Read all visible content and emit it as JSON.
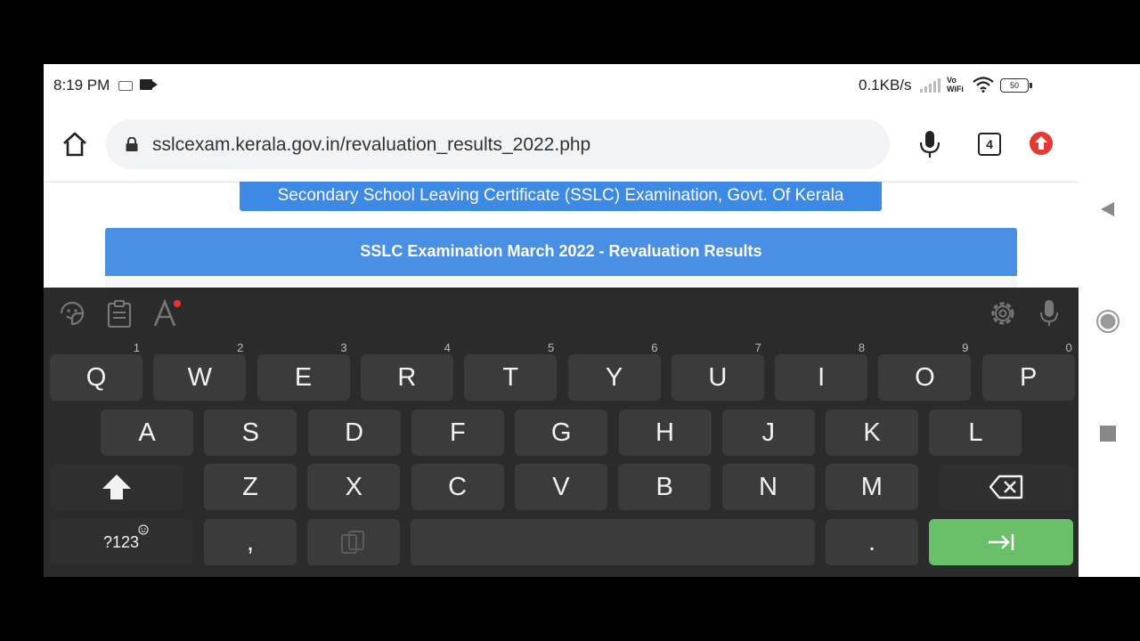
{
  "status_bar": {
    "time": "8:19 PM",
    "network_speed": "0.1KB/s",
    "vowifi_top": "Vo",
    "vowifi_bottom": "WiFi",
    "battery": "50"
  },
  "browser": {
    "url": "sslcexam.kerala.gov.in/revaluation_results_2022.php",
    "tab_count": "4"
  },
  "page": {
    "banner": "Secondary School Leaving Certificate (SSLC) Examination, Govt. Of Kerala",
    "results_title": "SSLC Examination March 2022 - Revaluation Results"
  },
  "keyboard": {
    "row1": [
      {
        "label": "Q",
        "hint": "1"
      },
      {
        "label": "W",
        "hint": "2"
      },
      {
        "label": "E",
        "hint": "3"
      },
      {
        "label": "R",
        "hint": "4"
      },
      {
        "label": "T",
        "hint": "5"
      },
      {
        "label": "Y",
        "hint": "6"
      },
      {
        "label": "U",
        "hint": "7"
      },
      {
        "label": "I",
        "hint": "8"
      },
      {
        "label": "O",
        "hint": "9"
      },
      {
        "label": "P",
        "hint": "0"
      }
    ],
    "row2": [
      "A",
      "S",
      "D",
      "F",
      "G",
      "H",
      "J",
      "K",
      "L"
    ],
    "row3": [
      "Z",
      "X",
      "C",
      "V",
      "B",
      "N",
      "M"
    ],
    "symbols_label": "?123",
    "comma": ",",
    "period": "."
  },
  "colors": {
    "banner_blue": "#3d8ae6",
    "header_blue": "#4a90e2",
    "action_green": "#6abf69",
    "keyboard_bg": "#2b2b2b"
  }
}
